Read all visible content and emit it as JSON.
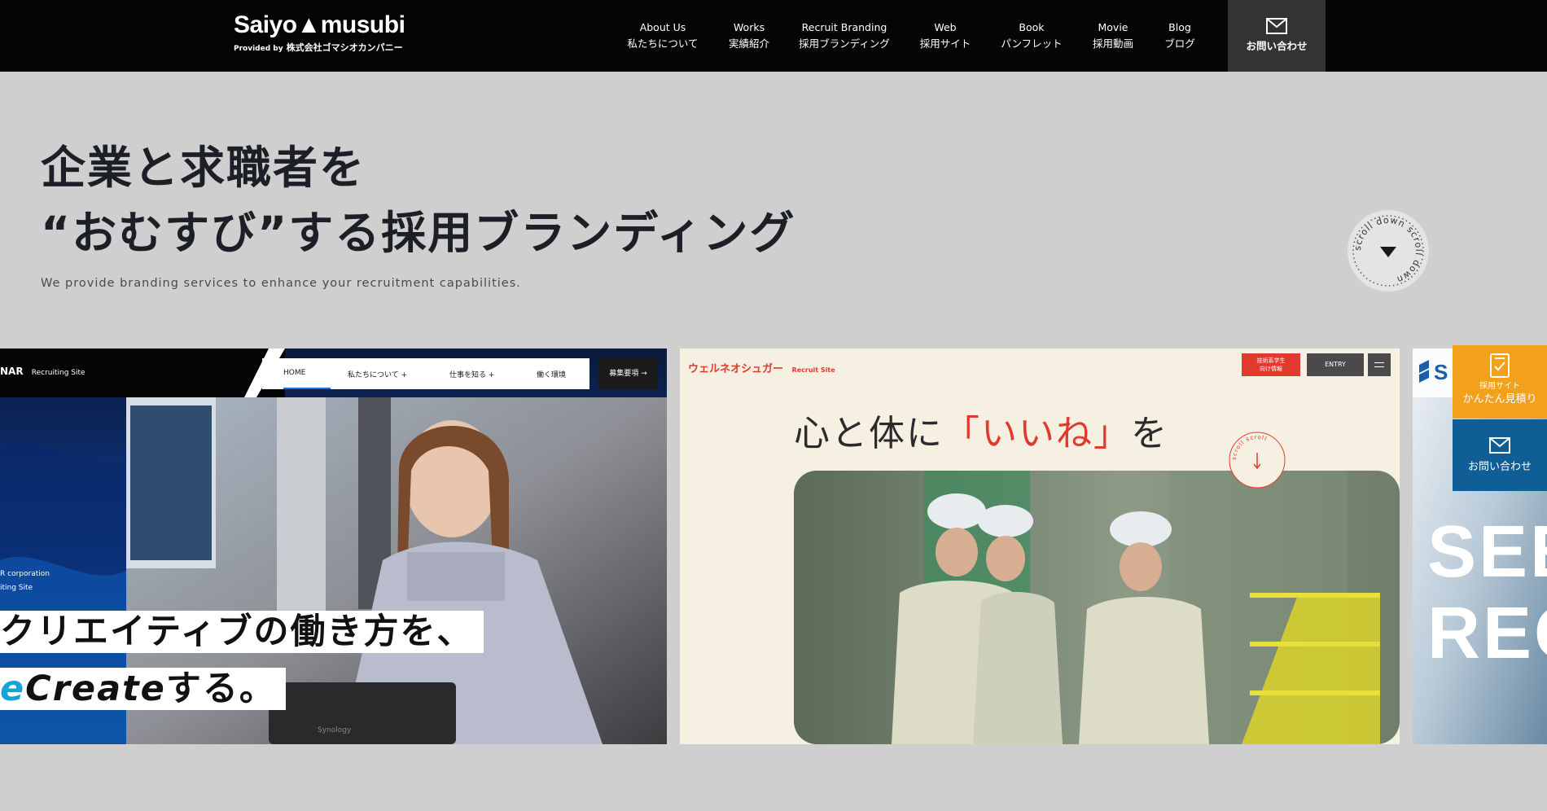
{
  "header": {
    "logo": "Saiyo▲musubi",
    "logo_by": "Provided by",
    "logo_company": "株式会社ゴマシオカンパニー",
    "nav": [
      {
        "en": "About Us",
        "ja": "私たちについて"
      },
      {
        "en": "Works",
        "ja": "実績紹介"
      },
      {
        "en": "Recruit Branding",
        "ja": "採用ブランディング"
      },
      {
        "en": "Web",
        "ja": "採用サイト"
      },
      {
        "en": "Book",
        "ja": "パンフレット"
      },
      {
        "en": "Movie",
        "ja": "採用動画"
      },
      {
        "en": "Blog",
        "ja": "ブログ"
      }
    ],
    "contact_label": "お問い合わせ"
  },
  "hero": {
    "title_line1": "企業と求職者を",
    "title_line2": "“おむすび”する採用ブランディング",
    "subtitle": "We provide branding services to enhance your recruitment capabilities.",
    "scroll_text": "scroll down scroll down"
  },
  "slide1": {
    "brand": "NAR",
    "brand_sub": "Recruiting Site",
    "nav": [
      "HOME",
      "私たちについて +",
      "仕事を知る +",
      "働く環境"
    ],
    "nav_cta": "募集要項",
    "corp_line1": "R corporation",
    "corp_line2": "iting Site",
    "copy_line1": "クリエイティブの働き方を、",
    "copy_line2_a": "e",
    "copy_line2_b": "Create",
    "copy_line2_c": "する。",
    "laptop_text": "Synology"
  },
  "slide2": {
    "brand": "ウェルネオシュガー",
    "brand_sub": "Recruit Site",
    "btn_students_1": "技術系学生",
    "btn_students_2": "向け情報",
    "btn_entry": "ENTRY",
    "headline_a": "心と体に",
    "headline_b": "「いいね」",
    "headline_c": "を",
    "scroll_text": "scroll scroll"
  },
  "slide3": {
    "brand": "S",
    "big1": "SEE",
    "big2": "REC"
  },
  "side": {
    "estimate_small": "採用サイト",
    "estimate_big": "かんたん見積り",
    "contact": "お問い合わせ"
  },
  "colors": {
    "header_bg": "#050505",
    "page_bg": "#cfcfcf",
    "estimate_orange": "#f3a11c",
    "contact_blue": "#0f5f96",
    "accent_red": "#e03a2e"
  }
}
